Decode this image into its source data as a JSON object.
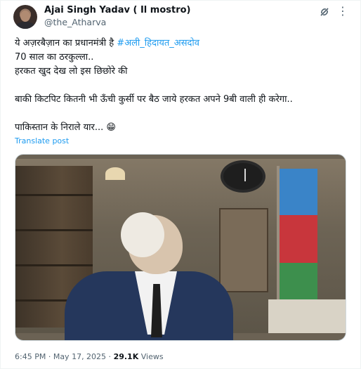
{
  "author": {
    "display_name": "Ajai Singh Yadav ( Il mostro)",
    "handle": "@the_Atharva"
  },
  "icons": {
    "grok": "grok-icon",
    "more": "more-icon",
    "more_glyph": "⋮"
  },
  "post": {
    "line1_text": "ये अज़रबैज़ान का प्रधानमंत्री है ",
    "line1_hashtag": "#अली_हिदायत_असदोव",
    "line2": "70 साल का ठरकुल्ला..",
    "line3": "हरकत खुद देख लो इस छिछोरे की",
    "line4": "बाकी किटपिट कितनी भी ऊँची कुर्सी पर बैठ जाये हरकत अपने 9बी वाली ही करेगा..",
    "line5": "पाकिस्तान के निराले यार... 😁",
    "translate_label": "Translate post"
  },
  "meta": {
    "time": "6:45 PM",
    "separator": " · ",
    "date": "May 17, 2025",
    "views_count": "29.1K",
    "views_label": " Views"
  },
  "colors": {
    "link": "#1d9bf0",
    "secondary_text": "#536471",
    "primary_text": "#0f1419"
  }
}
